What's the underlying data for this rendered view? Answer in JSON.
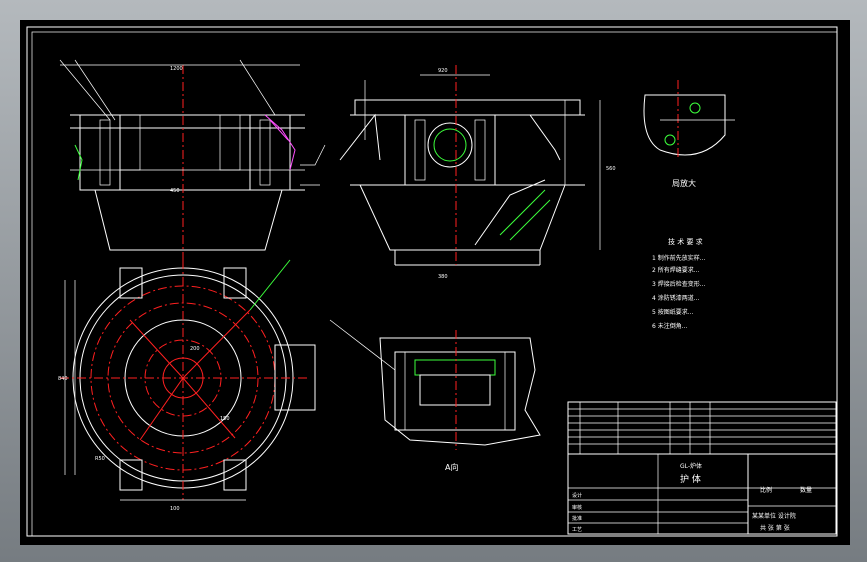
{
  "colors": {
    "background": "#000000",
    "outline": "#ffffff",
    "centerline": "#ff2020",
    "dimension": "#3cff3c",
    "hatch": "#ff4dff",
    "chrome": "#8e9498"
  },
  "drawing": {
    "view_label_a": "A向",
    "detail_label": "局放大",
    "tech_req_title": "技 术 要 求",
    "tech_req": [
      "1 制作前先放实样...",
      "2 所有焊缝要求...",
      "3 焊接后检查变形...",
      "4 涂防锈漆两道...",
      "5 按图纸要求...",
      "6 未注倒角..."
    ],
    "title_block": {
      "drawing_name": "护 体",
      "drawing_subtitle": "GL-炉体",
      "scale_label": "比例",
      "qty_label": "数量",
      "units": [
        "设计",
        "审核",
        "批准",
        "工艺"
      ],
      "org": "某某单位 设计院",
      "sheet": "共 张 第 张"
    },
    "dims": [
      "1200",
      "920",
      "450",
      "380",
      "200",
      "150",
      "100",
      "R50",
      "840",
      "560"
    ]
  }
}
